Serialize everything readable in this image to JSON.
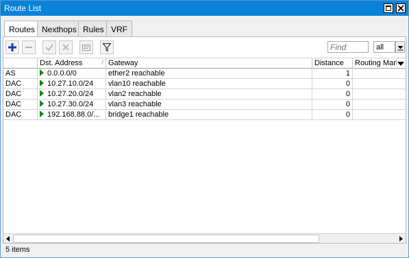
{
  "window": {
    "title": "Route List"
  },
  "tabs": [
    {
      "label": "Routes",
      "active": true
    },
    {
      "label": "Nexthops",
      "active": false
    },
    {
      "label": "Rules",
      "active": false
    },
    {
      "label": "VRF",
      "active": false
    }
  ],
  "toolbar": {
    "icons": [
      "add-icon",
      "remove-icon",
      "enable-icon",
      "disable-icon",
      "comment-icon",
      "filter-icon"
    ],
    "find_placeholder": "Find",
    "filter_value": "all"
  },
  "table": {
    "columns": [
      "",
      "Dst. Address",
      "Gateway",
      "Distance",
      "Routing Mark"
    ],
    "rows": [
      {
        "flags": "AS",
        "dst": "0.0.0.0/0",
        "gateway": "ether2 reachable",
        "distance": "1",
        "mark": ""
      },
      {
        "flags": "DAC",
        "dst": "10.27.10.0/24",
        "gateway": "vlan10 reachable",
        "distance": "0",
        "mark": ""
      },
      {
        "flags": "DAC",
        "dst": "10.27.20.0/24",
        "gateway": "vlan2 reachable",
        "distance": "0",
        "mark": ""
      },
      {
        "flags": "DAC",
        "dst": "10.27.30.0/24",
        "gateway": "vlan3 reachable",
        "distance": "0",
        "mark": ""
      },
      {
        "flags": "DAC",
        "dst": "192.168.88.0/...",
        "gateway": "bridge1 reachable",
        "distance": "0",
        "mark": ""
      }
    ]
  },
  "status": {
    "items_text": "5 items"
  },
  "colors": {
    "titlebar": "#0a82d8",
    "route_arrow": "#0b8a0b"
  }
}
